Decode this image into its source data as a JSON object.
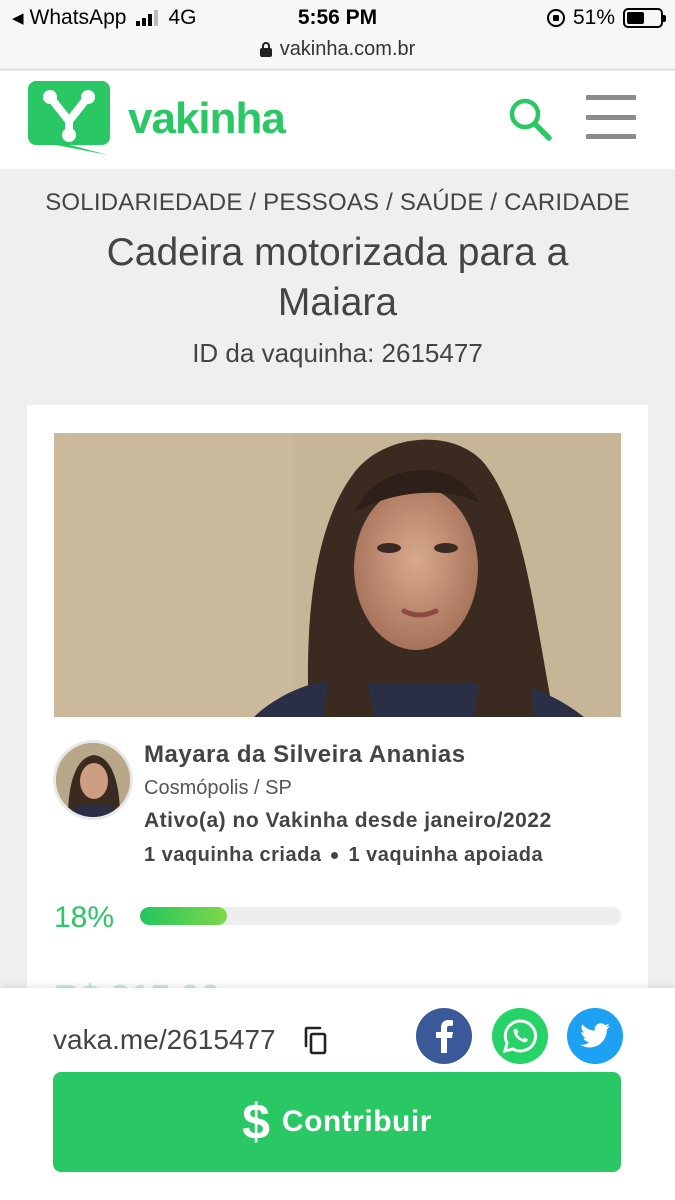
{
  "status_bar": {
    "back_app": "WhatsApp",
    "network": "4G",
    "time": "5:56 PM",
    "battery": "51%",
    "url": "vakinha.com.br"
  },
  "header": {
    "logo_text": "vakinha",
    "brand_color": "#2ac765",
    "search_icon": "search-icon",
    "menu_icon": "hamburger-menu-icon"
  },
  "campaign": {
    "categories": "SOLIDARIEDADE / PESSOAS / SAÚDE / CARIDADE",
    "title": "Cadeira motorizada para a Maiara",
    "id_text": "ID da vaquinha: 2615477"
  },
  "organizer": {
    "name": "Mayara da Silveira Ananias",
    "city": "Cosmópolis / SP",
    "since": "Ativo(a) no Vakinha desde janeiro/2022",
    "created": "1 vaquinha criada",
    "supported": "1 vaquinha apoiada"
  },
  "progress": {
    "percent_label": "18%",
    "fraction": 0.18,
    "color": "#2ac765"
  },
  "raised_partial": "R$ 215,00",
  "share": {
    "short_link": "vaka.me/2615477",
    "facebook_color": "#3b5998",
    "whatsapp_color": "#25d366",
    "twitter_color": "#1da1f2"
  },
  "cta": {
    "label": "Contribuir",
    "icon": "$"
  }
}
